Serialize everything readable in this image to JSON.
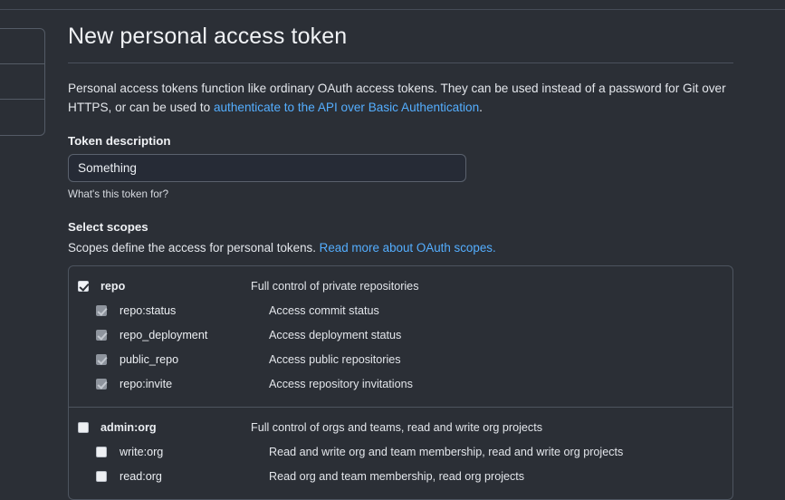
{
  "page": {
    "title": "New personal access token",
    "intro_part1": "Personal access tokens function like ordinary OAuth access tokens. They can be used instead of a password for Git over HTTPS, or can be used to ",
    "intro_link": "authenticate to the API over Basic Authentication",
    "intro_part2": "."
  },
  "token_description": {
    "label": "Token description",
    "value": "Something",
    "placeholder": "",
    "help": "What's this token for?"
  },
  "scopes": {
    "heading": "Select scopes",
    "sub_part1": "Scopes define the access for personal tokens. ",
    "sub_link": "Read more about OAuth scopes.",
    "groups": [
      {
        "name": "repo-group",
        "rows": [
          {
            "level": "parent",
            "state": "checked",
            "name": "repo",
            "desc": "Full control of private repositories"
          },
          {
            "level": "child",
            "state": "checked-disabled",
            "name": "repo:status",
            "desc": "Access commit status"
          },
          {
            "level": "child",
            "state": "checked-disabled",
            "name": "repo_deployment",
            "desc": "Access deployment status"
          },
          {
            "level": "child",
            "state": "checked-disabled",
            "name": "public_repo",
            "desc": "Access public repositories"
          },
          {
            "level": "child",
            "state": "checked-disabled",
            "name": "repo:invite",
            "desc": "Access repository invitations"
          }
        ]
      },
      {
        "name": "admin-org-group",
        "rows": [
          {
            "level": "parent",
            "state": "unchecked",
            "name": "admin:org",
            "desc": "Full control of orgs and teams, read and write org projects"
          },
          {
            "level": "child",
            "state": "unchecked",
            "name": "write:org",
            "desc": "Read and write org and team membership, read and write org projects"
          },
          {
            "level": "child",
            "state": "unchecked",
            "name": "read:org",
            "desc": "Read org and team membership, read org projects"
          }
        ]
      }
    ]
  },
  "sidebar": {
    "rows": [
      "",
      "",
      ""
    ]
  },
  "colors": {
    "background": "#2b2f36",
    "link": "#54aeff",
    "border": "#4d545f",
    "text": "#e6e9ee"
  }
}
